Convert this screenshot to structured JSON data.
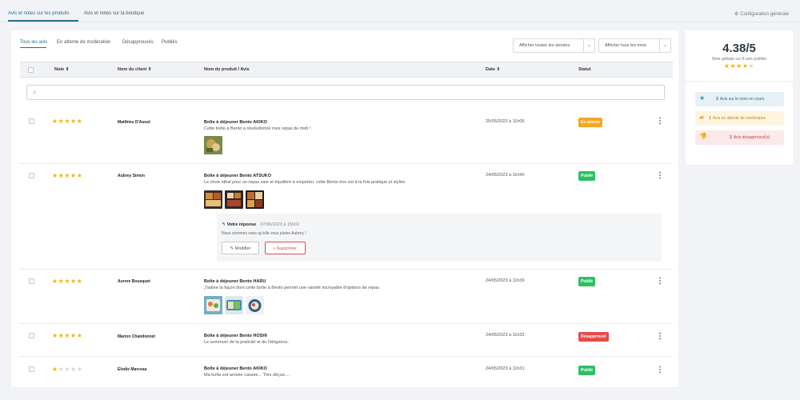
{
  "top_tabs": [
    {
      "label": "Avis et notes sur les produits",
      "active": true
    },
    {
      "label": "Avis et notes sur la boutique",
      "active": false
    }
  ],
  "config_link": {
    "icon": "gear-icon",
    "label": "Configuration générale"
  },
  "filter_tabs": [
    {
      "label": "Tous les avis",
      "active": true
    },
    {
      "label": "En attente de modération",
      "active": false
    },
    {
      "label": "Désapprouvés",
      "active": false
    },
    {
      "label": "Publiés",
      "active": false
    }
  ],
  "dropdowns": {
    "years": "Afficher toutes les années",
    "months": "Afficher tous les mois"
  },
  "columns": {
    "note": "Note",
    "customer": "Nom du client",
    "product": "Nom du produit / Avis",
    "date": "Date",
    "status": "Statut",
    "sort_icon": "sort-icon"
  },
  "search": {
    "placeholder": "",
    "value": ""
  },
  "reviews": [
    {
      "rating": 5,
      "customer": "Matthieu D'Auust",
      "product": "Boîte à déjeuner Bento AKIKO",
      "text": "Cette boîte à Bento a révolutionné mes repas de midi !",
      "date": "25/05/2023 à 11h05",
      "status": "En attente",
      "status_type": "pending",
      "photos": 1
    },
    {
      "rating": 5,
      "customer": "Aubrey Simon",
      "product": "Boîte à déjeuner Bento ATSUKO",
      "text": "Le choix idéal pour un repas sain et équilibré à emporter, cette Bento box est à la fois pratique et stylée.",
      "date": "24/05/2023 à 11h40",
      "status": "Publié",
      "status_type": "published",
      "photos": 3,
      "reply": {
        "title": "Votre réponse",
        "date": "07/06/2023 à 15h02",
        "text": "Nous sommes ravis qu'elle vous plaise Aubrey !",
        "edit_label": "Modifier",
        "delete_label": "Supprimer"
      }
    },
    {
      "rating": 5,
      "customer": "Aurore Bousquet",
      "product": "Boîte à déjeuner Bento HARU",
      "text": "J'adore la façon dont cette boîte à Bento permet une variété incroyable d'options de repas.",
      "date": "24/05/2023 à 11h39",
      "status": "Publié",
      "status_type": "published",
      "photos": 3
    },
    {
      "rating": 5,
      "customer": "Marion Chandonnet",
      "product": "Boîte à déjeuner Bento HOSHI",
      "text": "Le summum de la praticité et de l'élégance.",
      "date": "24/05/2023 à 11h33",
      "status": "Désapprouvé",
      "status_type": "rejected",
      "photos": 0
    },
    {
      "rating": 1,
      "customer": "Elodie Marceau",
      "product": "Boîte à déjeuner Bento AKIKO",
      "text": "Ma boîte est arrivée cassée... Très déçue....",
      "date": "24/05/2023 à 11h31",
      "status": "Publié",
      "status_type": "published",
      "photos": 0
    }
  ],
  "summary": {
    "average": "4.38/5",
    "caption": "Note globale sur 8 avis publiés",
    "rating_fraction": 0.876,
    "stats": [
      {
        "icon": "star-icon",
        "count": "3",
        "label": "Avis sur le mois en cours"
      },
      {
        "icon": "comment-icon",
        "count": "1",
        "label": "Avis en attente de modération"
      },
      {
        "icon": "thumbs-down-icon",
        "count": "2",
        "label": "Avis désapprouvé(s)"
      }
    ]
  },
  "colors": {
    "accent": "#2b6d8c",
    "star": "#f5b400",
    "pending": "#f5a623",
    "published": "#2fbf63",
    "rejected": "#e54b4b"
  }
}
